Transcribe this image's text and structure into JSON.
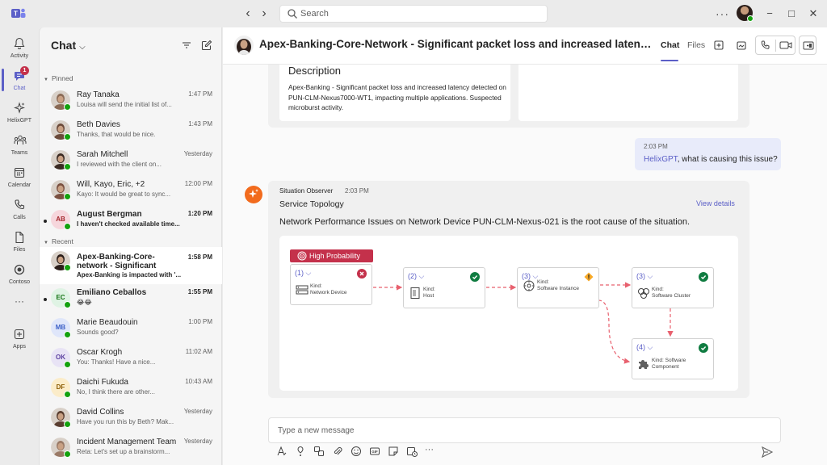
{
  "titlebar": {
    "search_placeholder": "Search",
    "more_label": "···"
  },
  "rail": {
    "items": [
      {
        "label": "Activity"
      },
      {
        "label": "Chat",
        "badge": "1"
      },
      {
        "label": "HelixGPT"
      },
      {
        "label": "Teams"
      },
      {
        "label": "Calendar"
      },
      {
        "label": "Calls"
      },
      {
        "label": "Files"
      },
      {
        "label": "Contoso"
      },
      {
        "label": "···"
      },
      {
        "label": "Apps"
      }
    ]
  },
  "chatlist": {
    "title": "Chat",
    "pinned_label": "Pinned",
    "recent_label": "Recent",
    "pinned": [
      {
        "name": "Ray Tanaka",
        "preview": "Louisa will send the initial list of...",
        "time": "1:47 PM",
        "color": "#8a6a55"
      },
      {
        "name": "Beth Davies",
        "preview": "Thanks, that would be nice.",
        "time": "1:43 PM",
        "color": "#6b4a3a"
      },
      {
        "name": "Sarah Mitchell",
        "preview": "I reviewed with the client on...",
        "time": "Yesterday",
        "color": "#3a2a22"
      },
      {
        "name": "Will, Kayo, Eric, +2",
        "preview": "Kayo: It would be great to sync...",
        "time": "12:00 PM",
        "color": "#7a5040"
      },
      {
        "name": "August Bergman",
        "preview": "I haven't checked available time...",
        "time": "1:20 PM",
        "initials": "AB",
        "init_bg": "#f6d6dc",
        "init_fg": "#a4262c",
        "unread": true
      }
    ],
    "recent": [
      {
        "name": "Apex-Banking-Core-network - Significant",
        "preview": "Apex-Banking is impacted with '...",
        "time": "1:58 PM",
        "color": "#2b1e1a",
        "selected": true,
        "unread": false
      },
      {
        "name": "Emiliano Ceballos",
        "preview": "😂😂",
        "time": "1:55 PM",
        "initials": "EC",
        "init_bg": "#dff3e4",
        "init_fg": "#0e700e",
        "unread": true
      },
      {
        "name": "Marie Beaudouin",
        "preview": "Sounds good?",
        "time": "1:00 PM",
        "initials": "MB",
        "init_bg": "#dfe6fa",
        "init_fg": "#3b5fc7"
      },
      {
        "name": "Oscar Krogh",
        "preview": "You: Thanks! Have a nice...",
        "time": "11:02 AM",
        "initials": "OK",
        "init_bg": "#e8e3f5",
        "init_fg": "#5b3fa0"
      },
      {
        "name": "Daichi Fukuda",
        "preview": "No, I think there are other...",
        "time": "10:43 AM",
        "initials": "DF",
        "init_bg": "#fbecc9",
        "init_fg": "#8a5a00"
      },
      {
        "name": "David Collins",
        "preview": "Have you run this by Beth? Mak...",
        "time": "Yesterday",
        "color": "#5a3e30"
      },
      {
        "name": "Incident Management Team",
        "preview": "Reta: Let's set up a brainstorm...",
        "time": "Yesterday",
        "color": "#9a7a66"
      }
    ]
  },
  "main": {
    "title": "Apex-Banking-Core-Network - Significant packet loss and increased latency det..",
    "tabs": [
      {
        "label": "Chat"
      },
      {
        "label": "Files"
      }
    ],
    "description_heading": "Description",
    "description_text": "Apex-Banking - Significant packet loss and increased latency detected on PUN-CLM-Nexus7000-WT1, impacting multiple applications. Suspected microburst activity.",
    "my_message": {
      "time": "2:03 PM",
      "mention": "HelixGPT",
      "text": ", what is causing this issue?"
    },
    "bot_message": {
      "sender": "Situation Observer",
      "time": "2:03 PM",
      "title": "Service Topology",
      "link": "View details",
      "text": "Network Performance Issues on Network Device PUN-CLM-Nexus-021 is the root cause of the situation.",
      "probability": "High Probability",
      "nodes": [
        {
          "idx": "(1)",
          "kind_label": "Kind:",
          "kind": "Network Device",
          "status": "error",
          "icon": "network-device-icon"
        },
        {
          "idx": "(2)",
          "kind_label": "Kind:",
          "kind": "Host",
          "status": "ok",
          "icon": "host-icon"
        },
        {
          "idx": "(3)",
          "kind_label": "Kind:",
          "kind": "Software Instance",
          "status": "warning",
          "icon": "software-instance-icon"
        },
        {
          "idx": "(3)",
          "kind_label": "Kind:",
          "kind": "Software Cluster",
          "status": "ok",
          "icon": "software-cluster-icon"
        },
        {
          "idx": "(4)",
          "kind_label": "Kind: Software",
          "kind": "Component",
          "status": "ok",
          "icon": "puzzle-icon"
        }
      ]
    },
    "compose_placeholder": "Type a new message"
  },
  "colors": {
    "accent": "#5b5fc7",
    "error": "#c4314b",
    "ok": "#107c41",
    "warning": "#f7a928",
    "edge": "#e8606e"
  }
}
